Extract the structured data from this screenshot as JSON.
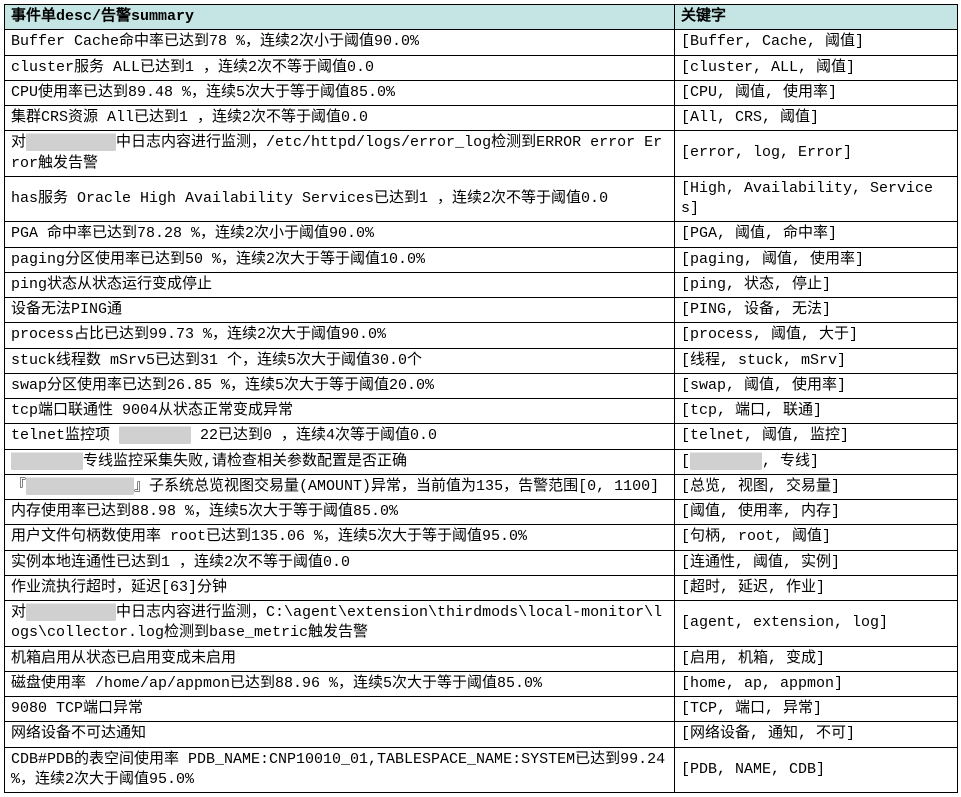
{
  "headers": {
    "desc": "事件单desc/告警summary",
    "kw": "关键字"
  },
  "rows": [
    {
      "desc": "Buffer Cache命中率已达到78 %，连续2次小于阈值90.0%",
      "kw": "[Buffer, Cache, 阈值]"
    },
    {
      "desc": "cluster服务 ALL已达到1 ，连续2次不等于阈值0.0",
      "kw": "[cluster, ALL, 阈值]"
    },
    {
      "desc": "CPU使用率已达到89.48 %，连续5次大于等于阈值85.0%",
      "kw": "[CPU, 阈值, 使用率]"
    },
    {
      "desc": "集群CRS资源 All已达到1 ，连续2次不等于阈值0.0",
      "kw": "[All, CRS, 阈值]"
    },
    {
      "desc": "对██████████中日志内容进行监测，/etc/httpd/logs/error_log检测到ERROR error Error触发告警",
      "kw": "[error, log, Error]"
    },
    {
      "desc": "has服务 Oracle High Availability Services已达到1 ，连续2次不等于阈值0.0",
      "kw": "[High, Availability, Services]"
    },
    {
      "desc": "PGA 命中率已达到78.28 %，连续2次小于阈值90.0%",
      "kw": "[PGA, 阈值, 命中率]"
    },
    {
      "desc": "paging分区使用率已达到50 %，连续2次大于等于阈值10.0%",
      "kw": "[paging, 阈值, 使用率]"
    },
    {
      "desc": "ping状态从状态运行变成停止",
      "kw": "[ping, 状态, 停止]"
    },
    {
      "desc": "设备无法PING通",
      "kw": "[PING, 设备, 无法]"
    },
    {
      "desc": "process占比已达到99.73 %，连续2次大于阈值90.0%",
      "kw": "[process, 阈值, 大于]"
    },
    {
      "desc": "stuck线程数 mSrv5已达到31 个，连续5次大于阈值30.0个",
      "kw": "[线程, stuck, mSrv]"
    },
    {
      "desc": "swap分区使用率已达到26.85 %，连续5次大于等于阈值20.0%",
      "kw": "[swap, 阈值, 使用率]"
    },
    {
      "desc": "tcp端口联通性 9004从状态正常变成异常",
      "kw": "[tcp, 端口, 联通]"
    },
    {
      "desc": "telnet监控项 ████████ 22已达到0 ，连续4次等于阈值0.0",
      "kw": "[telnet, 阈值, 监控]"
    },
    {
      "desc": "████████专线监控采集失败,请检查相关参数配置是否正确",
      "kw": "[████████, 专线]"
    },
    {
      "desc": "『████████████』子系统总览视图交易量(AMOUNT)异常，当前值为135，告警范围[0, 1100]",
      "kw": "[总览, 视图, 交易量]"
    },
    {
      "desc": "内存使用率已达到88.98 %，连续5次大于等于阈值85.0%",
      "kw": "[阈值, 使用率, 内存]"
    },
    {
      "desc": "用户文件句柄数使用率 root已达到135.06 %，连续5次大于等于阈值95.0%",
      "kw": "[句柄, root, 阈值]"
    },
    {
      "desc": "实例本地连通性已达到1 ，连续2次不等于阈值0.0",
      "kw": "[连通性, 阈值, 实例]"
    },
    {
      "desc": "作业流执行超时，延迟[63]分钟",
      "kw": "[超时, 延迟, 作业]"
    },
    {
      "desc": "对██████████中日志内容进行监测，C:\\agent\\extension\\thirdmods\\local-monitor\\logs\\collector.log检测到base_metric触发告警",
      "kw": "[agent, extension, log]"
    },
    {
      "desc": "机箱启用从状态已启用变成未启用",
      "kw": "[启用, 机箱, 变成]"
    },
    {
      "desc": "磁盘使用率 /home/ap/appmon已达到88.96 %，连续5次大于等于阈值85.0%",
      "kw": "[home, ap, appmon]"
    },
    {
      "desc": "9080 TCP端口异常",
      "kw": "[TCP, 端口, 异常]"
    },
    {
      "desc": "网络设备不可达通知",
      "kw": "[网络设备, 通知, 不可]"
    },
    {
      "desc": "CDB#PDB的表空间使用率 PDB_NAME:CNP10010_01,TABLESPACE_NAME:SYSTEM已达到99.24 %，连续2次大于阈值95.0%",
      "kw": "[PDB, NAME, CDB]"
    }
  ]
}
